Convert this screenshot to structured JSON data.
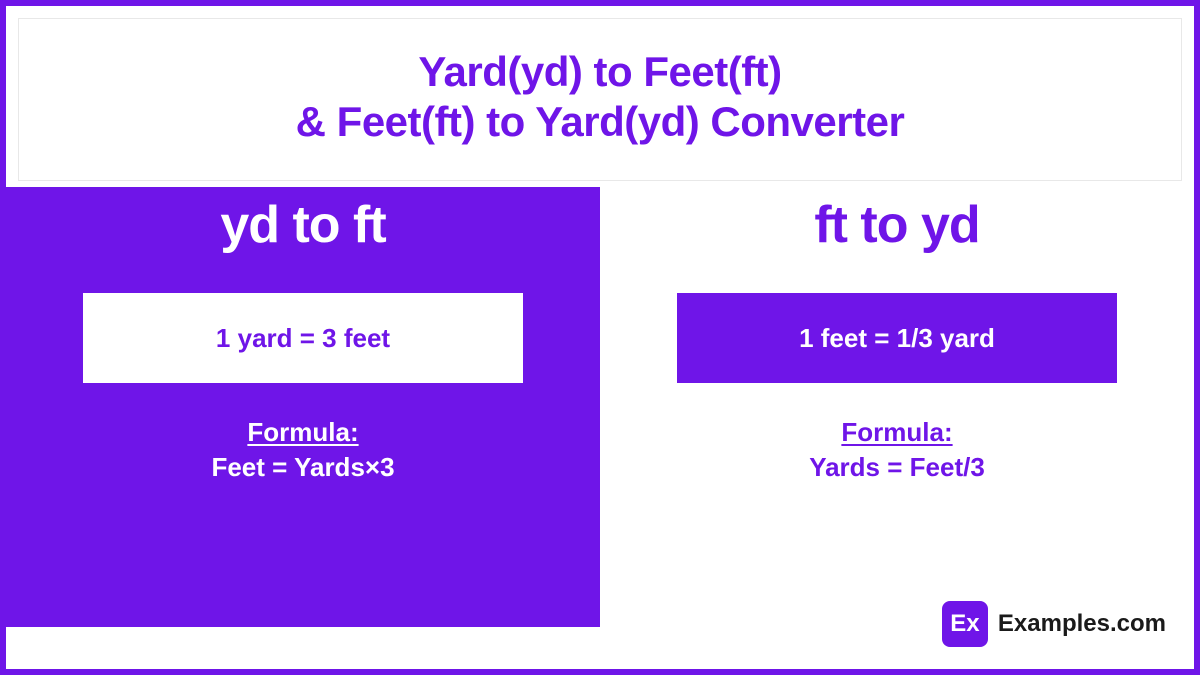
{
  "header": {
    "title_line1": "Yard(yd) to Feet(ft)",
    "title_line2": "&  Feet(ft) to Yard(yd) Converter"
  },
  "left": {
    "title": "yd to ft",
    "equation": "1 yard = 3 feet",
    "formula_label": "Formula:",
    "formula_text": "Feet = Yards×3"
  },
  "right": {
    "title": "ft to yd",
    "equation": "1 feet = 1/3 yard",
    "formula_label": "Formula: ",
    "formula_text": "Yards = Feet/3"
  },
  "brand": {
    "icon_text": "Ex",
    "name": "Examples.com"
  }
}
